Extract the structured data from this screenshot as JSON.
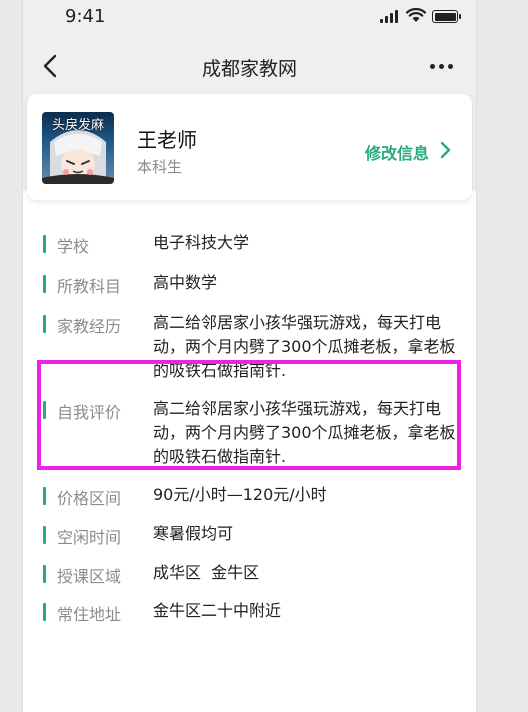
{
  "status_bar": {
    "time": "9:41"
  },
  "nav": {
    "title": "成都家教网"
  },
  "profile": {
    "avatar_text": "头戾发麻",
    "name": "王老师",
    "degree": "本科生",
    "edit_label": "修改信息"
  },
  "info": [
    {
      "label": "学校",
      "value": "电子科技大学"
    },
    {
      "label": "所教科目",
      "value": "高中数学"
    },
    {
      "label": "家教经历",
      "value": "高二给邻居家小孩华强玩游戏，每天打电动，两个月内劈了300个瓜摊老板，拿老板的吸铁石做指南针."
    },
    {
      "label": "自我评价",
      "value": "高二给邻居家小孩华强玩游戏，每天打电动，两个月内劈了300个瓜摊老板，拿老板的吸铁石做指南针."
    },
    {
      "label": "价格区间",
      "value": "90元/小时—120元/小时"
    },
    {
      "label": "空闲时间",
      "value": "寒暑假均可"
    },
    {
      "label": "授课区域",
      "value": "成华区  金牛区"
    },
    {
      "label": "常住地址",
      "value": "金牛区二十中附近"
    }
  ],
  "colors": {
    "accent": "#2aa97e",
    "highlight": "#ec22e6"
  }
}
